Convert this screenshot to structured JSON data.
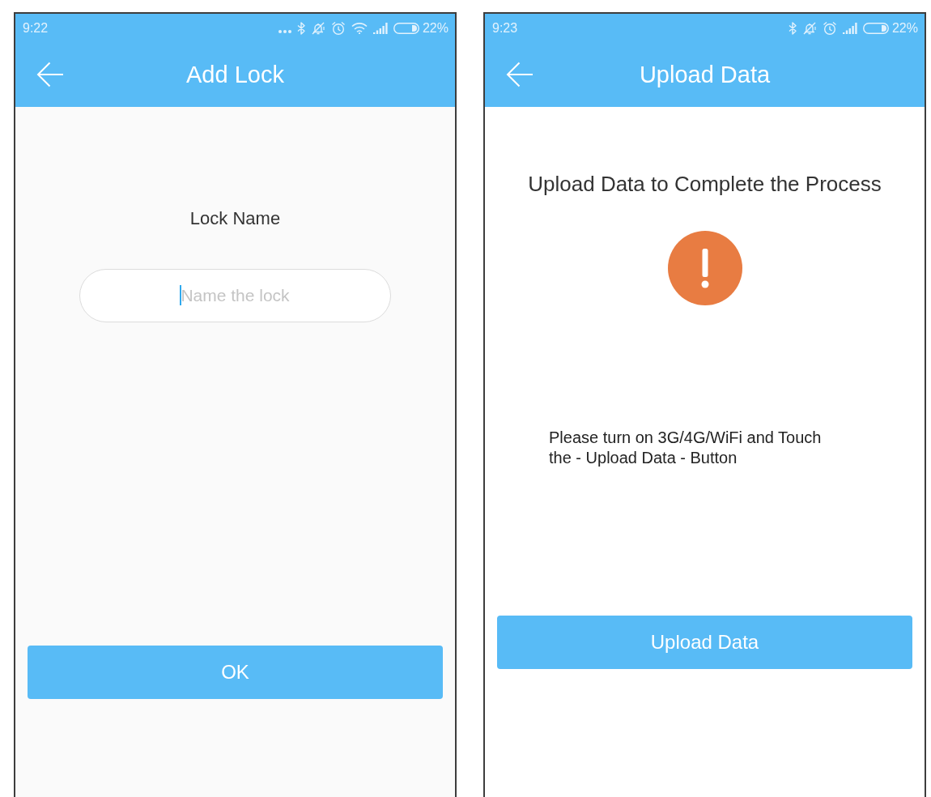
{
  "screens": [
    {
      "kind": "form",
      "status_bar": {
        "time": "9:22",
        "icons": [
          {
            "kind": "more"
          },
          {
            "kind": "bluetooth"
          },
          {
            "kind": "mute"
          },
          {
            "kind": "alarm"
          },
          {
            "kind": "wifi"
          },
          {
            "kind": "signal"
          },
          {
            "kind": "battery"
          }
        ],
        "battery": "22%"
      },
      "title": "Add Lock",
      "label": "Lock Name",
      "name_field": {
        "placeholder": "Name the lock",
        "focused": true
      },
      "button": "OK"
    },
    {
      "kind": "message",
      "status_bar": {
        "time": "9:23",
        "icons": [
          {
            "kind": "bluetooth"
          },
          {
            "kind": "mute"
          },
          {
            "kind": "alarm"
          },
          {
            "kind": "signal"
          },
          {
            "kind": "battery"
          }
        ],
        "battery": "22%"
      },
      "title": "Upload Data",
      "heading": "Upload Data to Complete the Process",
      "message": "Please turn on 3G/4G/WiFi and Touch the - Upload Data - Button",
      "button": "Upload Data"
    }
  ]
}
